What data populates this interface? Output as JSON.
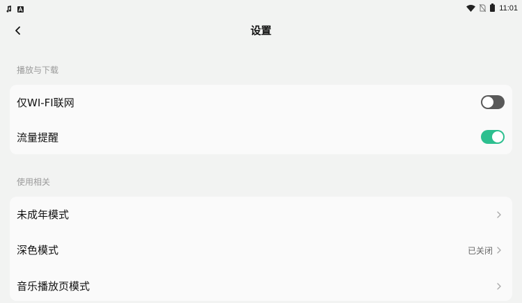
{
  "status_bar": {
    "time": "11:01",
    "icons": [
      "music-note-icon",
      "app-a-icon",
      "wifi-icon",
      "no-sim-icon",
      "battery-icon"
    ]
  },
  "header": {
    "title": "设置",
    "back_icon": "chevron-left-icon"
  },
  "sections": [
    {
      "title": "播放与下载",
      "rows": [
        {
          "label": "仅WI-FI联网",
          "control": "toggle",
          "toggle_on": false
        },
        {
          "label": "流量提醒",
          "control": "toggle",
          "toggle_on": true
        }
      ]
    },
    {
      "title": "使用相关",
      "rows": [
        {
          "label": "未成年模式",
          "control": "chevron",
          "value": ""
        },
        {
          "label": "深色模式",
          "control": "chevron",
          "value": "已关闭"
        },
        {
          "label": "音乐播放页模式",
          "control": "chevron",
          "value": ""
        }
      ]
    }
  ],
  "colors": {
    "background": "#f2f3f2",
    "card": "#fafafa",
    "toggle_on": "#2dbf8f",
    "toggle_off": "#595959",
    "section_title": "#9a9a9a"
  }
}
